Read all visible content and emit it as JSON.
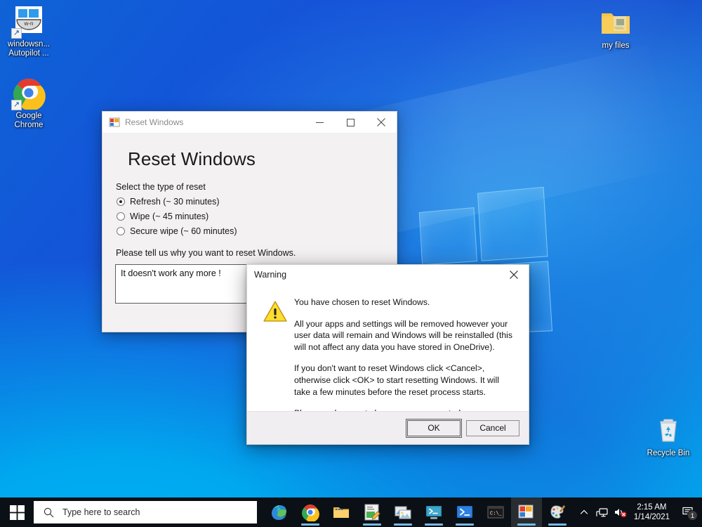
{
  "desktop": {
    "icons": [
      {
        "name": "windows-autopilot-shortcut",
        "label": "windowsn... Autopilot ...",
        "icon": "windows-script-shortcut-icon",
        "badge": "w-n"
      },
      {
        "name": "google-chrome-shortcut",
        "label": "Google Chrome",
        "icon": "chrome-icon"
      },
      {
        "name": "my-files-folder",
        "label": "my files",
        "icon": "folder-icon"
      },
      {
        "name": "recycle-bin",
        "label": "Recycle Bin",
        "icon": "recycle-bin-icon"
      }
    ]
  },
  "app_window": {
    "title": "Reset Windows",
    "title_icon": "application-form-icon",
    "heading": "Reset Windows",
    "minimize_label": "Minimize",
    "maximize_label": "Maximize",
    "close_label": "Close",
    "reset_type_label": "Select the type of reset",
    "reset_options": [
      {
        "label": "Refresh (~ 30 minutes)",
        "checked": true
      },
      {
        "label": "Wipe (~ 45 minutes)",
        "checked": false
      },
      {
        "label": "Secure wipe (~ 60 minutes)",
        "checked": false
      }
    ],
    "reason_label": "Please tell us why you want to reset Windows.",
    "reason_value": "It doesn't work any more !",
    "reason_placeholder": ""
  },
  "warning_dialog": {
    "title": "Warning",
    "close_label": "Close",
    "icon": "warning-triangle-icon",
    "paragraphs": [
      "You have chosen to reset Windows.",
      "All your apps and settings will be removed however your user data will remain and Windows will be reinstalled (this will not affect any data you have stored in OneDrive).",
      "If you don't want to reset Windows click <Cancel>, otherwise click <OK> to start resetting Windows. It will take a few minutes before the reset process starts.",
      "Please make sure to have power connected."
    ],
    "ok_label": "OK",
    "cancel_label": "Cancel"
  },
  "taskbar": {
    "start_label": "Start",
    "search": {
      "placeholder": "Type here to search",
      "icon": "search-icon"
    },
    "apps": [
      {
        "name": "taskbar-edge",
        "label": "Microsoft Edge",
        "icon": "edge-icon",
        "running": false,
        "active": false
      },
      {
        "name": "taskbar-chrome",
        "label": "Google Chrome",
        "icon": "chrome-icon",
        "running": true,
        "active": false
      },
      {
        "name": "taskbar-file-explorer",
        "label": "File Explorer",
        "icon": "folder-icon",
        "running": false,
        "active": false
      },
      {
        "name": "taskbar-notepad-editor",
        "label": "Editor",
        "icon": "notepad-edit-icon",
        "running": true,
        "active": false
      },
      {
        "name": "taskbar-photos",
        "label": "Photos",
        "icon": "photos-icon",
        "running": true,
        "active": false
      },
      {
        "name": "taskbar-powershell-ise",
        "label": "Windows PowerShell ISE",
        "icon": "powershell-ise-icon",
        "running": true,
        "active": false
      },
      {
        "name": "taskbar-powershell",
        "label": "Windows PowerShell",
        "icon": "powershell-icon",
        "running": true,
        "active": false
      },
      {
        "name": "taskbar-command-prompt",
        "label": "Command Prompt",
        "icon": "command-prompt-icon",
        "running": false,
        "active": false
      },
      {
        "name": "taskbar-reset-windows",
        "label": "Reset Windows",
        "icon": "application-form-icon",
        "running": true,
        "active": true
      },
      {
        "name": "taskbar-paint",
        "label": "Paint",
        "icon": "paint-palette-icon",
        "running": true,
        "active": false
      }
    ],
    "tray": {
      "show_hidden_icons": "chevron-up-icon",
      "network": "network-monitor-icon",
      "volume": "volume-muted-icon",
      "time": "2:15 AM",
      "date": "1/14/2021",
      "notifications_icon": "action-center-icon",
      "notifications_count": "1"
    }
  },
  "colors": {
    "accent": "#0078d7",
    "wallpaper_deep_blue": "#1b4fd8",
    "wallpaper_cyan": "#00aeef",
    "taskbar": "#0b1016",
    "warning_yellow": "#ffcc00",
    "running_indicator": "#76b9e8"
  }
}
